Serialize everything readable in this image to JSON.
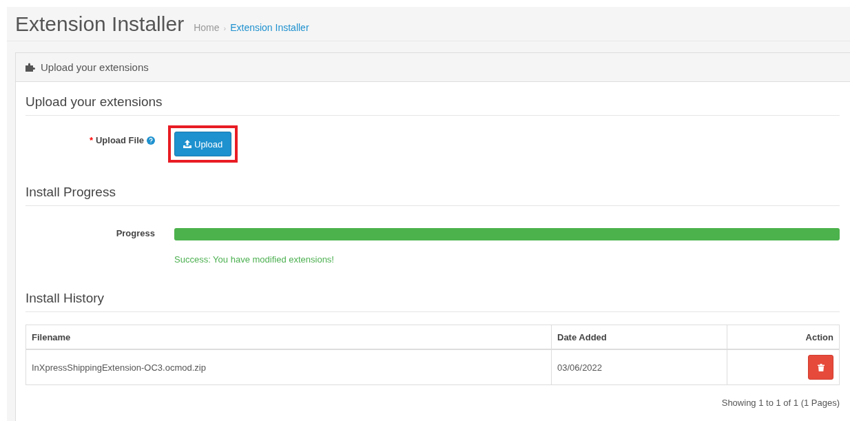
{
  "page_header": {
    "title": "Extension Installer",
    "breadcrumb_separator": "›",
    "breadcrumb": [
      {
        "label": "Home",
        "selected": false
      },
      {
        "label": "Extension Installer",
        "selected": true
      }
    ]
  },
  "panel": {
    "title": "Upload your extensions"
  },
  "upload_section": {
    "heading": "Upload your extensions",
    "label": "Upload File",
    "required_mark": "*",
    "button": "Upload",
    "highlighted": true
  },
  "progress_section": {
    "heading": "Install Progress",
    "label": "Progress",
    "level": 1,
    "message": "Success: You have modified extensions!"
  },
  "history_section": {
    "heading": "Install History",
    "table": {
      "columns": [
        "Filename",
        "Date Added",
        "Action"
      ],
      "rows": [
        {
          "filename": "InXpressShippingExtension-OC3.ocmod.zip",
          "date_added": "03/06/2022"
        }
      ]
    },
    "pagination": "Showing 1 to 1 of 1 (1 Pages)"
  }
}
